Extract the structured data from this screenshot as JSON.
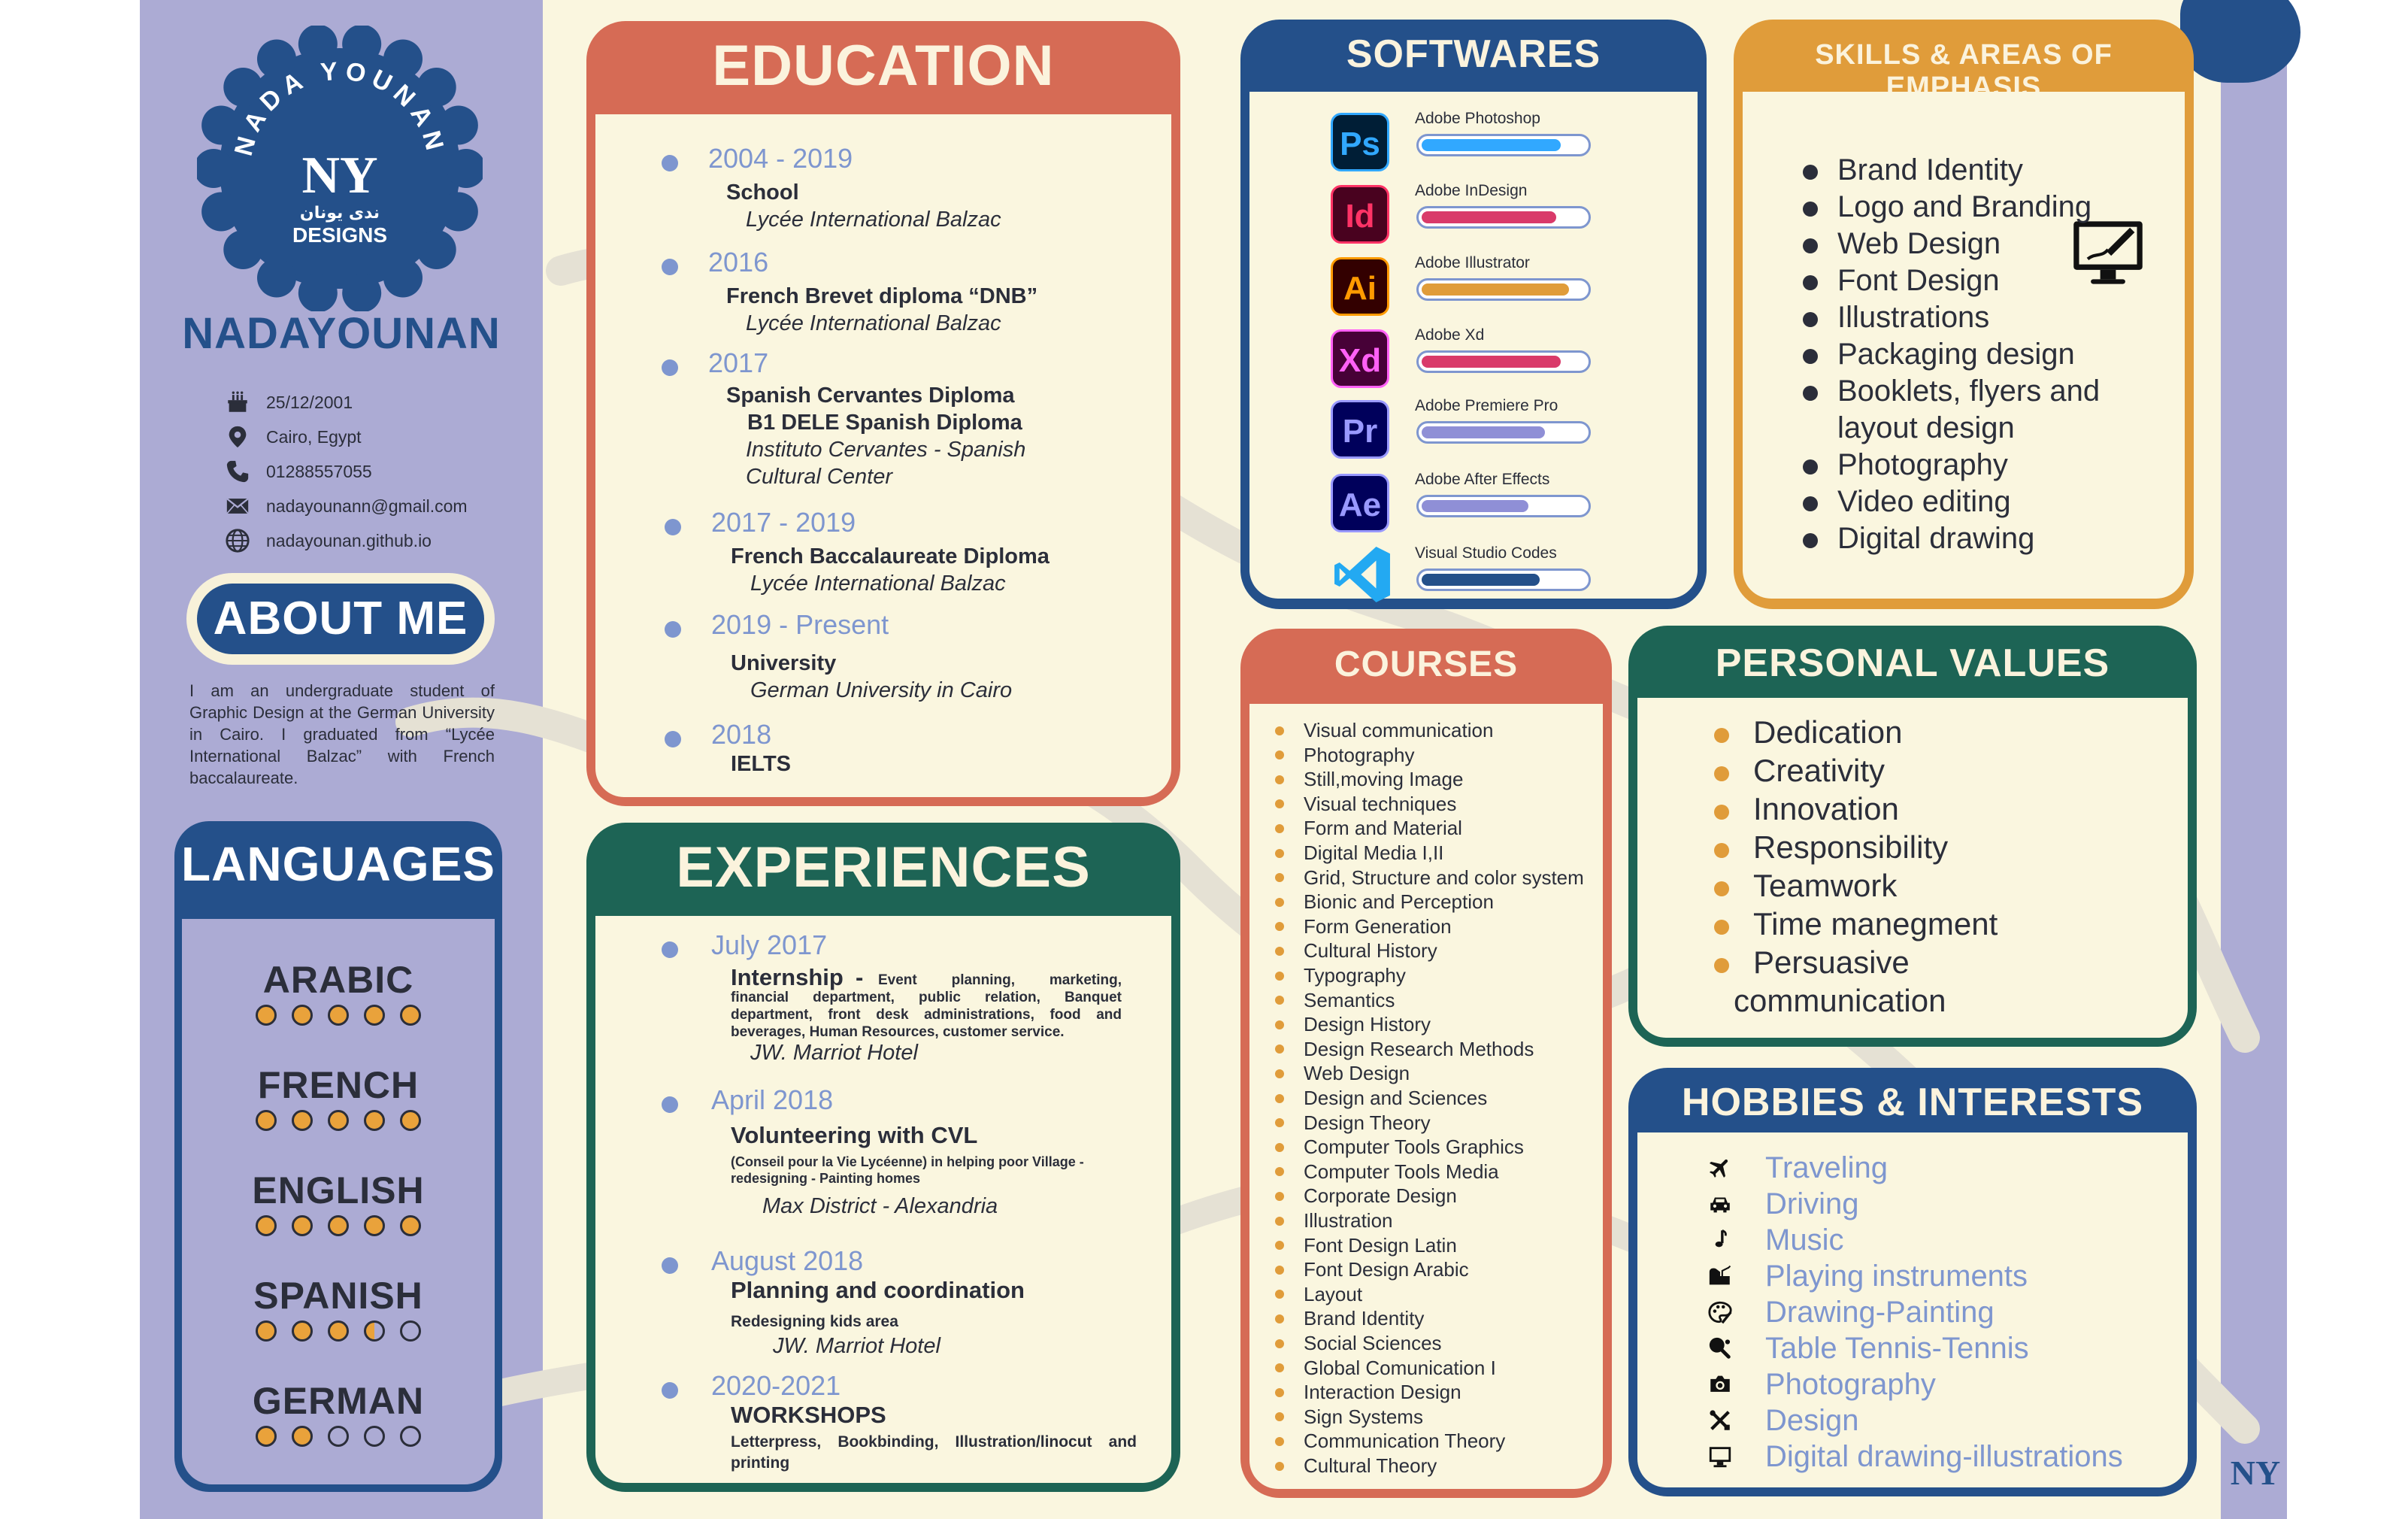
{
  "colors": {
    "navy": "#24508a",
    "coral": "#d66b55",
    "teal": "#1d6455",
    "mustard": "#e09c3a",
    "lavender": "#acabd4",
    "cream": "#faf6df",
    "periwinkle": "#7e96cf"
  },
  "sidebar": {
    "badge": {
      "arc_text": "NADA YOUNAN",
      "monogram": "NY",
      "arabic": "ندى يونان",
      "designs": "DESIGNS"
    },
    "brand_name": "NADAYOUNAN",
    "contacts": [
      {
        "icon": "cake-icon",
        "text": "25/12/2001"
      },
      {
        "icon": "location-pin-icon",
        "text": "Cairo, Egypt"
      },
      {
        "icon": "phone-icon",
        "text": "01288557055"
      },
      {
        "icon": "email-icon",
        "text": "nadayounann@gmail.com"
      },
      {
        "icon": "globe-icon",
        "text": "nadayounan.github.io"
      }
    ],
    "about_title": "ABOUT ME",
    "about_text": "I am an undergraduate student of Graphic Design at the German University in Cairo. I graduated from “Lycée International Balzac” with French baccalaureate.",
    "languages_title": "LANGUAGES",
    "languages": [
      {
        "name": "ARABIC",
        "level": 5
      },
      {
        "name": "FRENCH",
        "level": 5
      },
      {
        "name": "ENGLISH",
        "level": 5
      },
      {
        "name": "SPANISH",
        "level": 3.5
      },
      {
        "name": "GERMAN",
        "level": 2
      }
    ]
  },
  "education": {
    "title": "EDUCATION",
    "items": [
      {
        "year": "2004 - 2019",
        "line1": "School",
        "line2": "Lycée International Balzac"
      },
      {
        "year": "2016",
        "line1": "French Brevet diploma “DNB”",
        "line2": "Lycée International Balzac"
      },
      {
        "year": "2017",
        "line1": "Spanish Cervantes Diploma",
        "line1b": "B1 DELE Spanish Diploma",
        "line2": "Instituto Cervantes - Spanish",
        "line3": "Cultural Center"
      },
      {
        "year": "2017 - 2019",
        "line1": "French Baccalaureate Diploma",
        "line2": "Lycée International Balzac"
      },
      {
        "year": "2019 - Present",
        "line1": "University",
        "line2": "German University in Cairo"
      },
      {
        "year": "2018",
        "line1": "IELTS"
      }
    ]
  },
  "experiences": {
    "title": "EXPERIENCES",
    "items": [
      {
        "year": "July 2017",
        "role": "Internship",
        "sep": " - ",
        "desc": "Event planning, marketing, financial department, public relation, Banquet department, front desk administrations, food and beverages, Human Resources, customer service.",
        "place": "JW. Marriot Hotel"
      },
      {
        "year": "April 2018",
        "role": "Volunteering with CVL",
        "desc": "(Conseil pour la Vie Lycéenne)  in helping poor Village - redesigning - Painting homes",
        "place": "Max District - Alexandria"
      },
      {
        "year": "August 2018",
        "role": "Planning and coordination",
        "desc": "Redesigning kids area",
        "place": "JW. Marriot Hotel"
      },
      {
        "year": "2020-2021",
        "role": "WORKSHOPS",
        "desc": "Letterpress,   Bookbinding,   Illustration/linocut and printing"
      }
    ]
  },
  "softwares": {
    "title": "SOFTWARES",
    "items": [
      {
        "abbr": "Ps",
        "name": "Adobe Photoshop",
        "level": 0.85,
        "color": "#31a8ff",
        "bg": "#001e36",
        "bar": "#31a8ff"
      },
      {
        "abbr": "Id",
        "name": "Adobe InDesign",
        "level": 0.82,
        "color": "#ff3366",
        "bg": "#49021f",
        "bar": "#d93a6a"
      },
      {
        "abbr": "Ai",
        "name": "Adobe Illustrator",
        "level": 0.9,
        "color": "#ff9a00",
        "bg": "#330000",
        "bar": "#e09c3a"
      },
      {
        "abbr": "Xd",
        "name": "Adobe Xd",
        "level": 0.85,
        "color": "#ff61f6",
        "bg": "#470137",
        "bar": "#d93a6a"
      },
      {
        "abbr": "Pr",
        "name": "Adobe Premiere Pro",
        "level": 0.75,
        "color": "#9999ff",
        "bg": "#00005b",
        "bar": "#8f8fd6"
      },
      {
        "abbr": "Ae",
        "name": "Adobe After Effects",
        "level": 0.65,
        "color": "#9999ff",
        "bg": "#00005b",
        "bar": "#8f8fd6"
      },
      {
        "abbr": "VS",
        "name": "Visual Studio Codes",
        "level": 0.72,
        "color": "#23a9f2",
        "bg": "none",
        "bar": "#24508a"
      }
    ]
  },
  "skills": {
    "title": "SKILLS & AREAS OF EMPHASIS",
    "items": [
      [
        "Brand Identity"
      ],
      [
        "Logo and Branding"
      ],
      [
        "Web Design"
      ],
      [
        "Font Design"
      ],
      [
        "Illustrations"
      ],
      [
        "Packaging design"
      ],
      [
        "Booklets, flyers and",
        "layout design"
      ],
      [
        "Photography"
      ],
      [
        "Video editing"
      ],
      [
        "Digital drawing"
      ]
    ],
    "icon": "monitor-pen-icon"
  },
  "courses": {
    "title": "COURSES",
    "items": [
      "Visual communication",
      "Photography",
      "Still,moving Image",
      "Visual techniques",
      "Form and Material",
      "Digital Media I,II",
      "Grid, Structure and color system",
      "Bionic and Perception",
      "Form Generation",
      "Cultural History",
      "Typography",
      "Semantics",
      "Design History",
      "Design Research Methods",
      "Web Design",
      "Design and Sciences",
      "Design Theory",
      "Computer Tools Graphics",
      "Computer Tools Media",
      "Corporate Design",
      "Illustration",
      "Font Design Latin",
      "Font Design Arabic",
      "Layout",
      "Brand Identity",
      "Social Sciences",
      "Global Comunication I",
      "Interaction Design",
      "Sign Systems",
      "Communication Theory",
      "Cultural Theory"
    ]
  },
  "values": {
    "title": "PERSONAL VALUES",
    "items": [
      [
        "Dedication"
      ],
      [
        "Creativity"
      ],
      [
        "Innovation"
      ],
      [
        "Responsibility"
      ],
      [
        "Teamwork"
      ],
      [
        "Time manegment"
      ],
      [
        "Persuasive",
        "communication"
      ]
    ]
  },
  "hobbies": {
    "title": "HOBBIES & INTERESTS",
    "items": [
      {
        "icon": "airplane-icon",
        "text": "Traveling"
      },
      {
        "icon": "car-icon",
        "text": "Driving"
      },
      {
        "icon": "music-note-icon",
        "text": "Music"
      },
      {
        "icon": "piano-icon",
        "text": "Playing instruments"
      },
      {
        "icon": "palette-icon",
        "text": "Drawing-Painting"
      },
      {
        "icon": "ping-pong-icon",
        "text": "Table Tennis-Tennis"
      },
      {
        "icon": "camera-icon",
        "text": "Photography"
      },
      {
        "icon": "design-tools-icon",
        "text": "Design"
      },
      {
        "icon": "monitor-icon",
        "text": "Digital drawing-illustrations"
      }
    ]
  },
  "corner_logo": "NY"
}
